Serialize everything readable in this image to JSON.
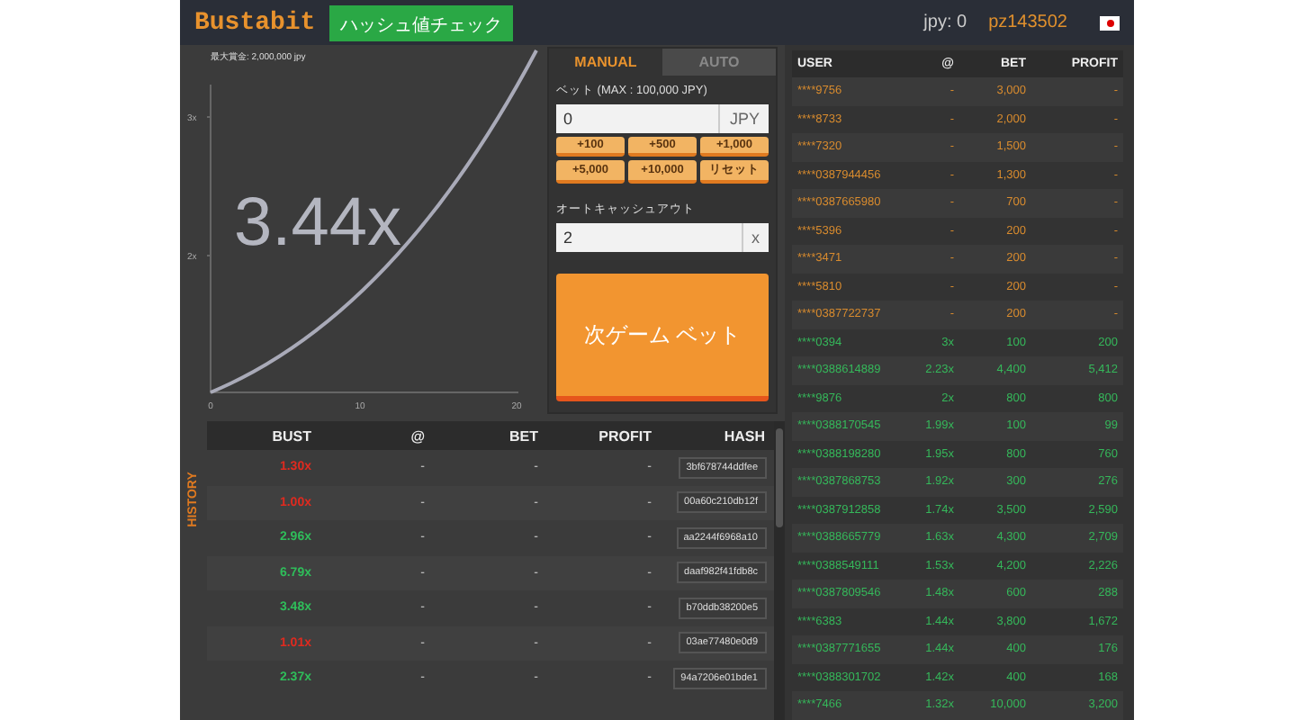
{
  "header": {
    "logo": "Bustabit",
    "hash_check_button": "ハッシュ値チェック",
    "balance": "jpy: 0",
    "username": "pz143502"
  },
  "graph": {
    "max_profit": "最大賞金: 2,000,000 jpy",
    "multiplier": "3.44x",
    "y_ticks": [
      "3x",
      "2x"
    ],
    "x_ticks": [
      "0",
      "10",
      "20"
    ]
  },
  "bet_panel": {
    "tabs": [
      {
        "label": "MANUAL",
        "selected": true
      },
      {
        "label": "AUTO",
        "selected": false
      }
    ],
    "bet_label": "ベット (MAX : 100,000 JPY)",
    "bet_value": "0",
    "bet_unit": "JPY",
    "quick_buttons": [
      "+100",
      "+500",
      "+1,000",
      "+5,000",
      "+10,000",
      "リセット"
    ],
    "cashout_label": "オートキャッシュアウト",
    "cashout_value": "2",
    "cashout_unit": "x",
    "submit_button": "次ゲーム ベット"
  },
  "history": {
    "side_label": "HISTORY",
    "columns": [
      "BUST",
      "@",
      "BET",
      "PROFIT",
      "HASH"
    ],
    "rows": [
      {
        "bust": "1.30x",
        "color": "#e02a1f",
        "at": "-",
        "bet": "-",
        "profit": "-",
        "hash": "3bf678744ddfee"
      },
      {
        "bust": "1.00x",
        "color": "#e02a1f",
        "at": "-",
        "bet": "-",
        "profit": "-",
        "hash": "00a60c210db12f"
      },
      {
        "bust": "2.96x",
        "color": "#2fbd5a",
        "at": "-",
        "bet": "-",
        "profit": "-",
        "hash": "aa2244f6968a10"
      },
      {
        "bust": "6.79x",
        "color": "#2fbd5a",
        "at": "-",
        "bet": "-",
        "profit": "-",
        "hash": "daaf982f41fdb8c"
      },
      {
        "bust": "3.48x",
        "color": "#2fbd5a",
        "at": "-",
        "bet": "-",
        "profit": "-",
        "hash": "b70ddb38200e5"
      },
      {
        "bust": "1.01x",
        "color": "#e02a1f",
        "at": "-",
        "bet": "-",
        "profit": "-",
        "hash": "03ae77480e0d9"
      },
      {
        "bust": "2.37x",
        "color": "#2fbd5a",
        "at": "-",
        "bet": "-",
        "profit": "-",
        "hash": "94a7206e01bde1"
      }
    ]
  },
  "players": {
    "columns": [
      "USER",
      "@",
      "BET",
      "PROFIT"
    ],
    "rows": [
      {
        "user": "****9756",
        "at": "-",
        "bet": "3,000",
        "profit": "-",
        "cashed_out": false
      },
      {
        "user": "****8733",
        "at": "-",
        "bet": "2,000",
        "profit": "-",
        "cashed_out": false
      },
      {
        "user": "****7320",
        "at": "-",
        "bet": "1,500",
        "profit": "-",
        "cashed_out": false
      },
      {
        "user": "****0387944456",
        "at": "-",
        "bet": "1,300",
        "profit": "-",
        "cashed_out": false
      },
      {
        "user": "****0387665980",
        "at": "-",
        "bet": "700",
        "profit": "-",
        "cashed_out": false
      },
      {
        "user": "****5396",
        "at": "-",
        "bet": "200",
        "profit": "-",
        "cashed_out": false
      },
      {
        "user": "****3471",
        "at": "-",
        "bet": "200",
        "profit": "-",
        "cashed_out": false
      },
      {
        "user": "****5810",
        "at": "-",
        "bet": "200",
        "profit": "-",
        "cashed_out": false
      },
      {
        "user": "****0387722737",
        "at": "-",
        "bet": "200",
        "profit": "-",
        "cashed_out": false
      },
      {
        "user": "****0394",
        "at": "3x",
        "bet": "100",
        "profit": "200",
        "cashed_out": true
      },
      {
        "user": "****0388614889",
        "at": "2.23x",
        "bet": "4,400",
        "profit": "5,412",
        "cashed_out": true
      },
      {
        "user": "****9876",
        "at": "2x",
        "bet": "800",
        "profit": "800",
        "cashed_out": true
      },
      {
        "user": "****0388170545",
        "at": "1.99x",
        "bet": "100",
        "profit": "99",
        "cashed_out": true
      },
      {
        "user": "****0388198280",
        "at": "1.95x",
        "bet": "800",
        "profit": "760",
        "cashed_out": true
      },
      {
        "user": "****0387868753",
        "at": "1.92x",
        "bet": "300",
        "profit": "276",
        "cashed_out": true
      },
      {
        "user": "****0387912858",
        "at": "1.74x",
        "bet": "3,500",
        "profit": "2,590",
        "cashed_out": true
      },
      {
        "user": "****0388665779",
        "at": "1.63x",
        "bet": "4,300",
        "profit": "2,709",
        "cashed_out": true
      },
      {
        "user": "****0388549111",
        "at": "1.53x",
        "bet": "4,200",
        "profit": "2,226",
        "cashed_out": true
      },
      {
        "user": "****0387809546",
        "at": "1.48x",
        "bet": "600",
        "profit": "288",
        "cashed_out": true
      },
      {
        "user": "****6383",
        "at": "1.44x",
        "bet": "3,800",
        "profit": "1,672",
        "cashed_out": true
      },
      {
        "user": "****0387771655",
        "at": "1.44x",
        "bet": "400",
        "profit": "176",
        "cashed_out": true
      },
      {
        "user": "****0388301702",
        "at": "1.42x",
        "bet": "400",
        "profit": "168",
        "cashed_out": true
      },
      {
        "user": "****7466",
        "at": "1.32x",
        "bet": "10,000",
        "profit": "3,200",
        "cashed_out": true
      }
    ]
  }
}
